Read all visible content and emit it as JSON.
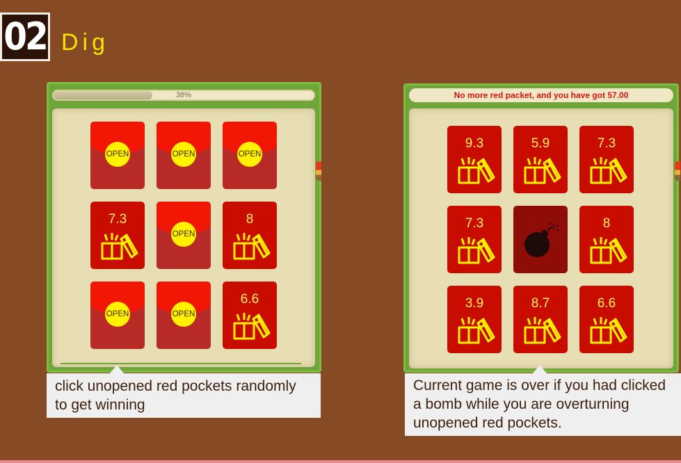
{
  "header": {
    "step_number": "02",
    "step_title": "Dig"
  },
  "left_panel": {
    "progress": {
      "label": "38%",
      "fraction": 0.38
    },
    "cards": [
      {
        "state": "closed",
        "button_label": "OPEN"
      },
      {
        "state": "closed",
        "button_label": "OPEN"
      },
      {
        "state": "closed",
        "button_label": "OPEN"
      },
      {
        "state": "opened",
        "amount": "7.3",
        "icon": "gift-icon"
      },
      {
        "state": "closed",
        "button_label": "OPEN"
      },
      {
        "state": "opened",
        "amount": "8",
        "icon": "gift-icon"
      },
      {
        "state": "closed",
        "button_label": "OPEN"
      },
      {
        "state": "closed",
        "button_label": "OPEN"
      },
      {
        "state": "opened",
        "amount": "6.6",
        "icon": "gift-icon"
      }
    ],
    "caption": "click unopened red pockets randomly to get winning"
  },
  "right_panel": {
    "status_message": "No more red packet, and you have got 57.00",
    "cards": [
      {
        "state": "opened",
        "amount": "9.3",
        "icon": "gift-icon"
      },
      {
        "state": "opened",
        "amount": "5.9",
        "icon": "gift-icon"
      },
      {
        "state": "opened",
        "amount": "7.3",
        "icon": "gift-icon"
      },
      {
        "state": "opened",
        "amount": "7.3",
        "icon": "gift-icon"
      },
      {
        "state": "bomb",
        "icon": "bomb-icon"
      },
      {
        "state": "opened",
        "amount": "8",
        "icon": "gift-icon"
      },
      {
        "state": "opened",
        "amount": "3.9",
        "icon": "gift-icon"
      },
      {
        "state": "opened",
        "amount": "8.7",
        "icon": "gift-icon"
      },
      {
        "state": "opened",
        "amount": "6.6",
        "icon": "gift-icon"
      }
    ],
    "caption": "Current game is over if you had clicked a bomb while you are overturning unopened red pockets."
  },
  "colors": {
    "background": "#864b24",
    "panel_green": "#6ea63a",
    "board_cream": "#e7deb4",
    "card_red": "#c80c00",
    "card_flap": "#f21605",
    "open_button_yellow": "#fff200",
    "amount_yellow": "#fff25a",
    "status_red": "#d4140f",
    "title_yellow": "#f4e300"
  }
}
